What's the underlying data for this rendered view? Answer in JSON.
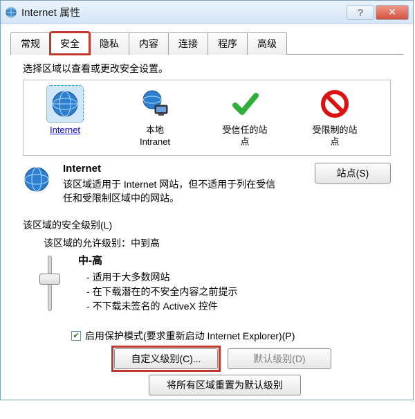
{
  "window": {
    "title": "Internet 属性"
  },
  "tabs": [
    "常规",
    "安全",
    "隐私",
    "内容",
    "连接",
    "程序",
    "高级"
  ],
  "active_tab_index": 1,
  "zone_prompt": "选择区域以查看或更改安全设置。",
  "zones": [
    {
      "label": "Internet",
      "sub": ""
    },
    {
      "label": "本地",
      "sub": "Intranet"
    },
    {
      "label": "受信任的站",
      "sub": "点"
    },
    {
      "label": "受限制的站",
      "sub": "点"
    }
  ],
  "selected_zone_index": 0,
  "sites_button": "站点(S)",
  "zone_detail": {
    "title": "Internet",
    "desc": "该区域适用于 Internet 网站，但不适用于列在受信任和受限制区域中的网站。"
  },
  "security_level_label": "该区域的安全级别(L)",
  "allowed_levels": "该区域的允许级别：中到高",
  "level": {
    "name": "中-高",
    "bullets": [
      "适用于大多数网站",
      "在下载潜在的不安全内容之前提示",
      "不下载未签名的 ActiveX 控件"
    ]
  },
  "protected_mode": {
    "checked": true,
    "label": "启用保护模式(要求重新启动 Internet Explorer)(P)"
  },
  "buttons": {
    "custom_level": "自定义级别(C)...",
    "default_level": "默认级别(D)",
    "reset_all": "将所有区域重置为默认级别"
  }
}
